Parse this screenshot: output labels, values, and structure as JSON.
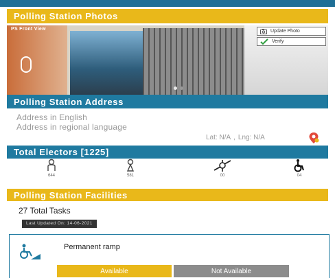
{
  "photos": {
    "header": "Polling Station Photos",
    "caption": "PS Front View",
    "update_label": "Update Photo",
    "verify_label": "Verify"
  },
  "address": {
    "header": "Polling Station Address",
    "english": "Address in English",
    "regional": "Address in regional language",
    "lat": "Lat: N/A",
    "lng": "Lng: N/A"
  },
  "electors": {
    "header": "Total Electors [1225]",
    "items": [
      {
        "icon": "male-icon",
        "count": "644"
      },
      {
        "icon": "female-icon",
        "count": "581"
      },
      {
        "icon": "third-gender-icon",
        "count": "00"
      },
      {
        "icon": "pwd-wheelchair-icon",
        "count": "04"
      }
    ]
  },
  "facilities": {
    "header": "Polling Station Facilities",
    "total_tasks": "27 Total Tasks",
    "last_updated": "Last Updated On: 14-06-2021",
    "item": {
      "name": "Permanent ramp",
      "available_label": "Available",
      "not_available_label": "Not Available"
    }
  },
  "colors": {
    "accent_yellow": "#e9b81a",
    "accent_teal": "#1f7aa0",
    "verify_check": "#2e9e3e"
  }
}
